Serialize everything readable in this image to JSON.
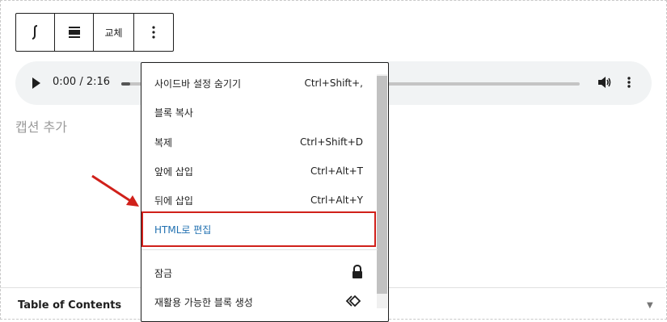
{
  "toolbar": {
    "replace_label": "교체"
  },
  "audio": {
    "time": "0:00 / 2:16",
    "progress": 0.02
  },
  "caption_placeholder": "캡션 추가",
  "toc_label": "Table of Contents",
  "menu": {
    "items": [
      {
        "label": "사이드바 설정 숨기기",
        "shortcut": "Ctrl+Shift+,"
      },
      {
        "label": "블록 복사",
        "shortcut": ""
      },
      {
        "label": "복제",
        "shortcut": "Ctrl+Shift+D"
      },
      {
        "label": "앞에 삽입",
        "shortcut": "Ctrl+Alt+T"
      },
      {
        "label": "뒤에 삽입",
        "shortcut": "Ctrl+Alt+Y"
      },
      {
        "label": "HTML로 편집",
        "shortcut": ""
      },
      {
        "label": "잠금",
        "shortcut": ""
      },
      {
        "label": "재활용 가능한 블록 생성",
        "shortcut": ""
      }
    ]
  },
  "colors": {
    "highlight": "#d0201a",
    "link": "#2271b1"
  }
}
